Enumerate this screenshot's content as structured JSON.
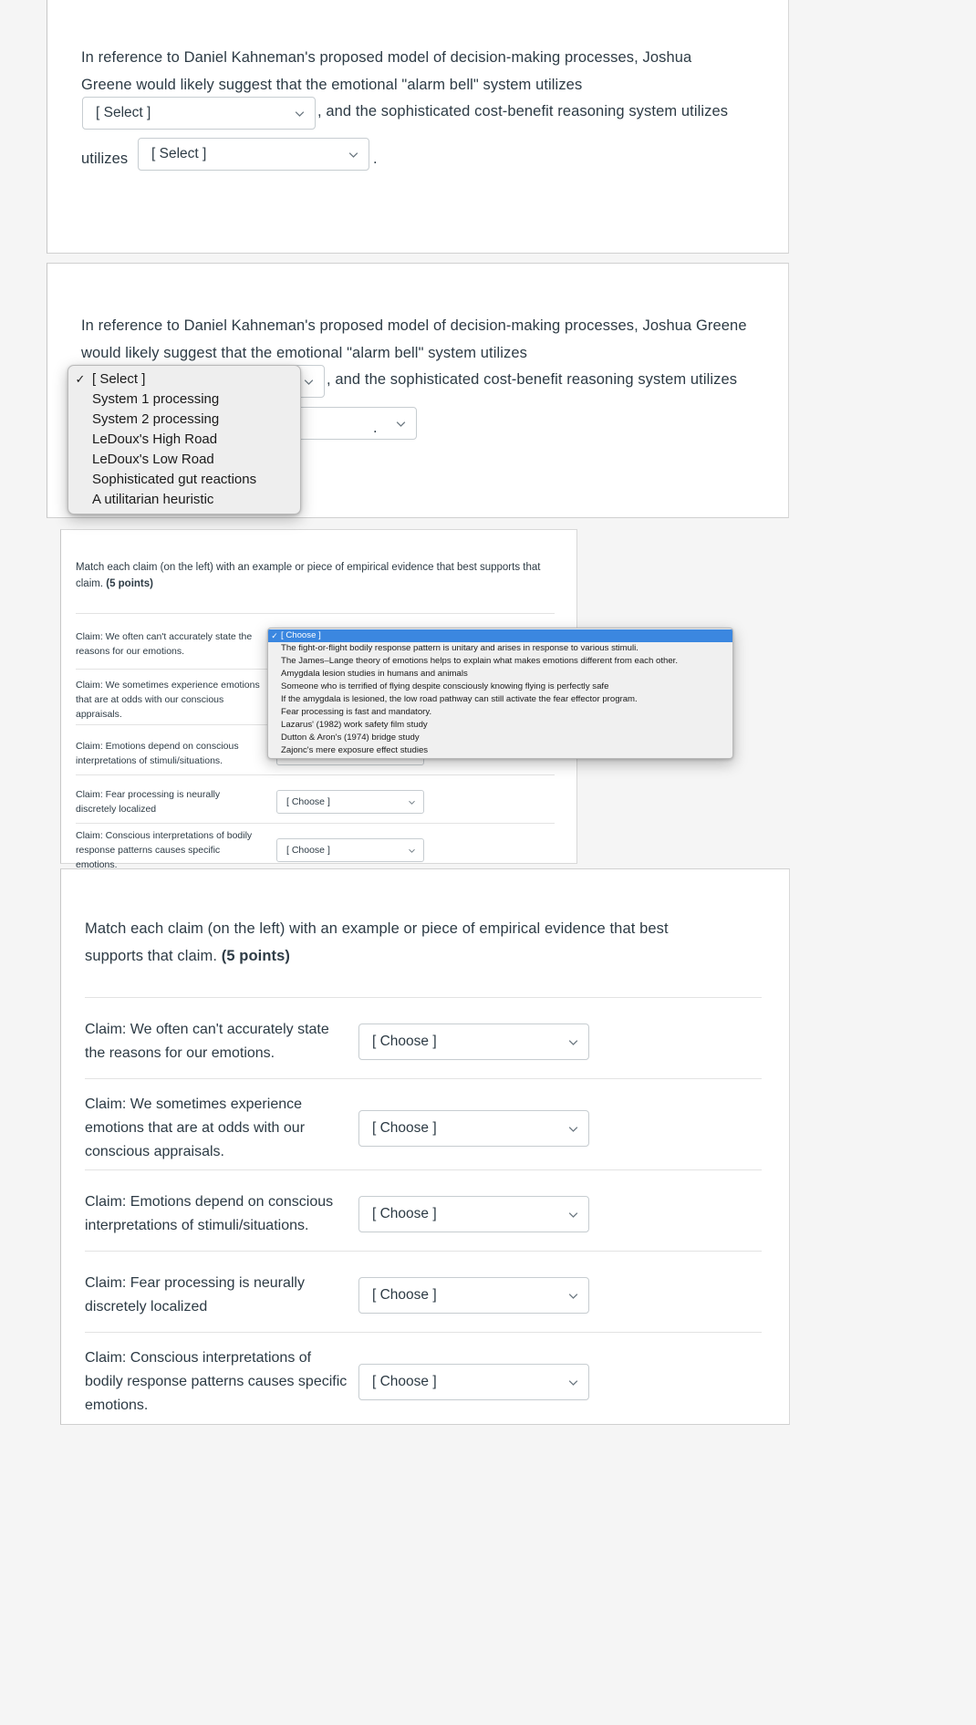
{
  "quiz": {
    "kahneman_question": {
      "text_part1": "In reference to Daniel Kahneman's proposed model of decision-making processes, Joshua Greene would likely suggest that the emotional \"alarm bell\" system utilizes",
      "text_part2": ", and the sophisticated cost-benefit reasoning system utilizes",
      "text_part3": ".",
      "select_placeholder": "[ Select ]",
      "chevron_icon": "chevron-down-icon"
    },
    "kahneman_dropdown": {
      "selected": "[ Select ]",
      "checkmark": "✓",
      "options": [
        "[ Select ]",
        "System 1 processing",
        "System 2 processing",
        "LeDoux's High Road",
        "LeDoux's Low Road",
        "Sophisticated gut reactions",
        "A utilitarian heuristic"
      ]
    },
    "matching_question": {
      "prompt_text": "Match each claim (on the left) with an example or piece of empirical evidence that best supports that claim.",
      "prompt_points": "(5 points)",
      "choose_placeholder": "[ Choose ]",
      "chevron_icon": "chevron-down-icon",
      "claims": [
        "Claim: We often can't accurately state the reasons for our emotions.",
        "Claim: We sometimes experience emotions that are at odds with our conscious appraisals.",
        "Claim: Emotions depend on conscious interpretations of stimuli/situations.",
        "Claim: Fear processing is neurally discretely localized",
        "Claim: Conscious interpretations of bodily response patterns causes specific emotions."
      ]
    },
    "evidence_dropdown": {
      "selected": "[ Choose ]",
      "checkmark": "✓",
      "highlight_color": "#3b87e0",
      "options": [
        "[ Choose ]",
        "The fight-or-flight bodily response pattern is unitary and arises in response to various stimuli.",
        "The James–Lange theory of emotions helps to explain what makes emotions different from each other.",
        "Amygdala lesion studies in humans and animals",
        "Someone who is terrified of flying despite consciously knowing flying is perfectly safe",
        "If the amygdala is lesioned, the low road pathway can still activate the fear effector program.",
        "Fear processing is fast and mandatory.",
        "Lazarus' (1982) work safety film study",
        "Dutton & Aron's (1974) bridge study",
        "Zajonc's mere exposure effect studies"
      ]
    }
  }
}
